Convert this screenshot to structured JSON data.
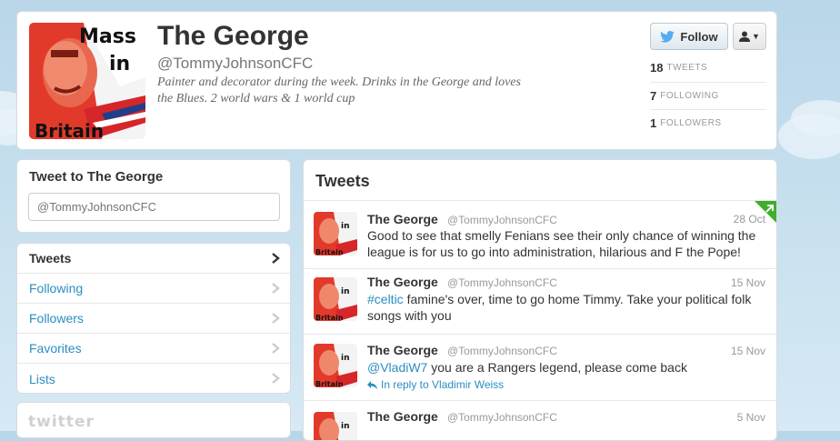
{
  "profile": {
    "name": "The George",
    "handle": "@TommyJohnsonCFC",
    "bio": "Painter and decorator during the week. Drinks in the George and loves the Blues. 2 world wars & 1 world cup",
    "follow_label": "Follow",
    "stats": [
      {
        "count": "18",
        "label": "TWEETS"
      },
      {
        "count": "7",
        "label": "FOLLOWING"
      },
      {
        "count": "1",
        "label": "FOLLOWERS"
      }
    ]
  },
  "tweet_to": {
    "title": "Tweet to The George",
    "placeholder": "@TommyJohnsonCFC"
  },
  "nav": {
    "items": [
      {
        "label": "Tweets"
      },
      {
        "label": "Following"
      },
      {
        "label": "Followers"
      },
      {
        "label": "Favorites"
      },
      {
        "label": "Lists"
      }
    ]
  },
  "logo_text": "twitter",
  "timeline": {
    "title": "Tweets",
    "tweets": [
      {
        "name": "The George",
        "handle": "@TommyJohnsonCFC",
        "time": "28 Oct",
        "text": "Good to see that smelly Fenians see their only chance of winning the league is for us to go into administration, hilarious and F the Pope!"
      },
      {
        "name": "The George",
        "handle": "@TommyJohnsonCFC",
        "time": "15 Nov",
        "hashtag": "#celtic",
        "text": " famine's over, time to go home Timmy. Take your political folk songs with you"
      },
      {
        "name": "The George",
        "handle": "@TommyJohnsonCFC",
        "time": "15 Nov",
        "mention": "@VladiW7",
        "text": " you are a Rangers legend, please come back",
        "reply": "In reply to Vladimir Weiss"
      },
      {
        "name": "The George",
        "handle": "@TommyJohnsonCFC",
        "time": "5 Nov",
        "text": ""
      }
    ]
  },
  "colors": {
    "link": "#2b8dc2",
    "follow_bird": "#55acee",
    "corner_flag": "#3fae2a"
  }
}
